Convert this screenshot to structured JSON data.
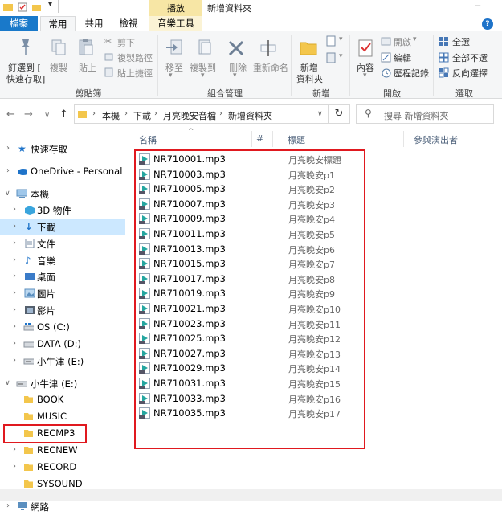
{
  "titlebar": {
    "title": "新增資料夾",
    "playback_tab": "播放"
  },
  "tabs": {
    "file": "檔案",
    "home": "常用",
    "share": "共用",
    "view": "檢視",
    "music_tools": "音樂工具",
    "help": "?"
  },
  "ribbon": {
    "clipboard": {
      "pin": "釘選到 [",
      "pin2": "快速存取]",
      "copy": "複製",
      "paste": "貼上",
      "cut": "剪下",
      "copy_path": "複製路徑",
      "paste_shortcut": "貼上捷徑",
      "group": "剪貼簿"
    },
    "organize": {
      "move_to": "移至",
      "copy_to": "複製到",
      "delete": "刪除",
      "rename": "重新命名",
      "group": "組合管理"
    },
    "new": {
      "new_folder": "新增",
      "new_folder2": "資料夾",
      "group": "新增"
    },
    "open": {
      "properties": "內容",
      "open": "開啟",
      "edit": "編輯",
      "history": "歷程記錄",
      "group": "開啟"
    },
    "select": {
      "select_all": "全選",
      "select_none": "全部不選",
      "invert": "反向選擇",
      "group": "選取"
    }
  },
  "address": {
    "crumbs": [
      "本機",
      "下載",
      "月亮晚安音檔",
      "新增資料夾"
    ],
    "search_placeholder": "搜尋 新增資料夾"
  },
  "nav": {
    "items": [
      {
        "label": "快速存取"
      },
      {
        "label": "OneDrive - Personal"
      },
      {
        "label": "本機"
      },
      {
        "label": "3D 物件"
      },
      {
        "label": "下載"
      },
      {
        "label": "文件"
      },
      {
        "label": "音樂"
      },
      {
        "label": "桌面"
      },
      {
        "label": "圖片"
      },
      {
        "label": "影片"
      },
      {
        "label": "OS (C:)"
      },
      {
        "label": "DATA (D:)"
      },
      {
        "label": "小牛津 (E:)"
      },
      {
        "label": "小牛津 (E:)"
      },
      {
        "label": "BOOK"
      },
      {
        "label": "MUSIC"
      },
      {
        "label": "RECMP3"
      },
      {
        "label": "RECNEW"
      },
      {
        "label": "RECORD"
      },
      {
        "label": "SYSOUND"
      },
      {
        "label": "網路"
      }
    ]
  },
  "list": {
    "columns": {
      "name": "名稱",
      "number": "#",
      "title": "標題",
      "artist": "參與演出者"
    },
    "files": [
      {
        "name": "NR710001.mp3",
        "title": "月亮晚安標題"
      },
      {
        "name": "NR710003.mp3",
        "title": "月亮晚安p1"
      },
      {
        "name": "NR710005.mp3",
        "title": "月亮晚安p2"
      },
      {
        "name": "NR710007.mp3",
        "title": "月亮晚安p3"
      },
      {
        "name": "NR710009.mp3",
        "title": "月亮晚安p4"
      },
      {
        "name": "NR710011.mp3",
        "title": "月亮晚安p5"
      },
      {
        "name": "NR710013.mp3",
        "title": "月亮晚安p6"
      },
      {
        "name": "NR710015.mp3",
        "title": "月亮晚安p7"
      },
      {
        "name": "NR710017.mp3",
        "title": "月亮晚安p8"
      },
      {
        "name": "NR710019.mp3",
        "title": "月亮晚安p9"
      },
      {
        "name": "NR710021.mp3",
        "title": "月亮晚安p10"
      },
      {
        "name": "NR710023.mp3",
        "title": "月亮晚安p11"
      },
      {
        "name": "NR710025.mp3",
        "title": "月亮晚安p12"
      },
      {
        "name": "NR710027.mp3",
        "title": "月亮晚安p13"
      },
      {
        "name": "NR710029.mp3",
        "title": "月亮晚安p14"
      },
      {
        "name": "NR710031.mp3",
        "title": "月亮晚安p15"
      },
      {
        "name": "NR710033.mp3",
        "title": "月亮晚安p16"
      },
      {
        "name": "NR710035.mp3",
        "title": "月亮晚安p17"
      }
    ]
  },
  "colors": {
    "accent": "#1979ca",
    "highlight": "#e0191f",
    "selection": "#cce8ff",
    "folder": "#f3c64c"
  }
}
